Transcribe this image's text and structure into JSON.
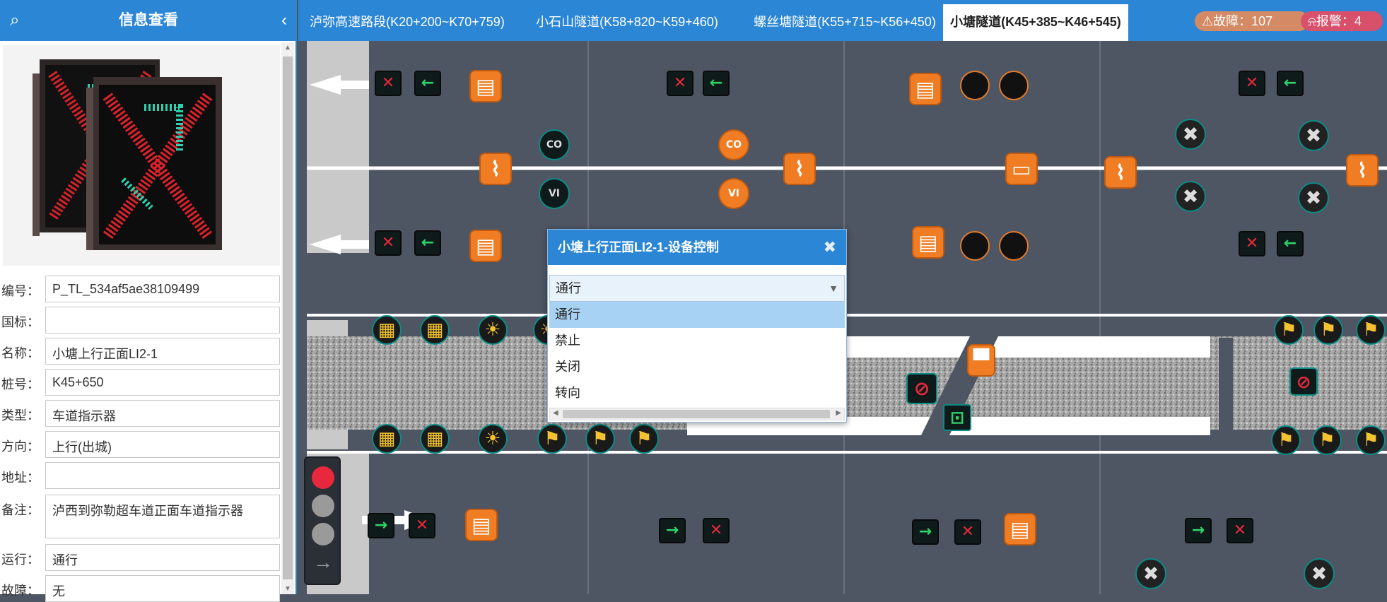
{
  "sidebar": {
    "title": "信息查看",
    "fields": [
      {
        "label": "编号：",
        "value": "P_TL_534af5ae38109499"
      },
      {
        "label": "国标：",
        "value": ""
      },
      {
        "label": "名称：",
        "value": "小塘上行正面LI2-1"
      },
      {
        "label": "桩号：",
        "value": "K45+650"
      },
      {
        "label": "类型：",
        "value": "车道指示器"
      },
      {
        "label": "方向：",
        "value": "上行(出城)"
      },
      {
        "label": "地址：",
        "value": ""
      },
      {
        "label": "备注：",
        "value": "泸西到弥勒超车道正面车道指示器"
      },
      {
        "label": "运行：",
        "value": "通行"
      },
      {
        "label": "故障：",
        "value": "无"
      }
    ]
  },
  "tabs": [
    {
      "label": "泸弥高速路段(K20+200~K70+759)",
      "active": false
    },
    {
      "label": "小石山隧道(K58+820~K59+460)",
      "active": false
    },
    {
      "label": "螺丝塘隧道(K55+715~K56+450)",
      "active": false
    },
    {
      "label": "小塘隧道(K45+385~K46+545)",
      "active": true
    }
  ],
  "badges": {
    "fault": "故障：107",
    "alarm": "报警：4"
  },
  "icons": {
    "search": "search-icon",
    "collapse": "chevron-left-icon",
    "fault": "warning-triangle-icon",
    "alarm": "alarm-bell-icon"
  },
  "dialog": {
    "title": "小塘上行正面LI2-1-设备控制",
    "close": "✖",
    "selected": "通行",
    "options": [
      "通行",
      "禁止",
      "关闭",
      "转向"
    ]
  },
  "devices": {
    "co_label": "CO",
    "vi_label": "VI"
  },
  "colors": {
    "accent": "#2b86d6",
    "road": "#4e5563",
    "device_orange": "#f07d23",
    "arrow_green": "#2fd36a",
    "cross_red": "#e8283c",
    "fault_badge": "#d48a64",
    "alarm_badge": "#d8506a"
  }
}
